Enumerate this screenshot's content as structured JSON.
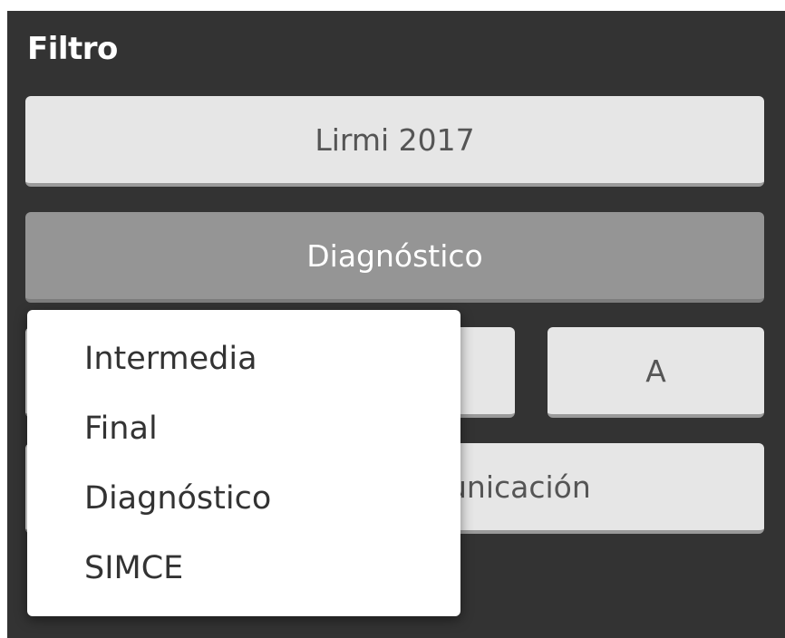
{
  "panel": {
    "title": "Filtro"
  },
  "filters": {
    "year_label": "Lirmi 2017",
    "evaluation_type_label": "Diagnóstico",
    "level_label": "",
    "course_label": "A",
    "subject_label": "unicación"
  },
  "dropdown": {
    "items": [
      {
        "label": "Intermedia"
      },
      {
        "label": "Final"
      },
      {
        "label": "Diagnóstico"
      },
      {
        "label": "SIMCE"
      }
    ]
  },
  "colors": {
    "panel_bg": "#333333",
    "button_light": "#e6e6e6",
    "button_selected": "#959595",
    "dropdown_bg": "#ffffff"
  }
}
